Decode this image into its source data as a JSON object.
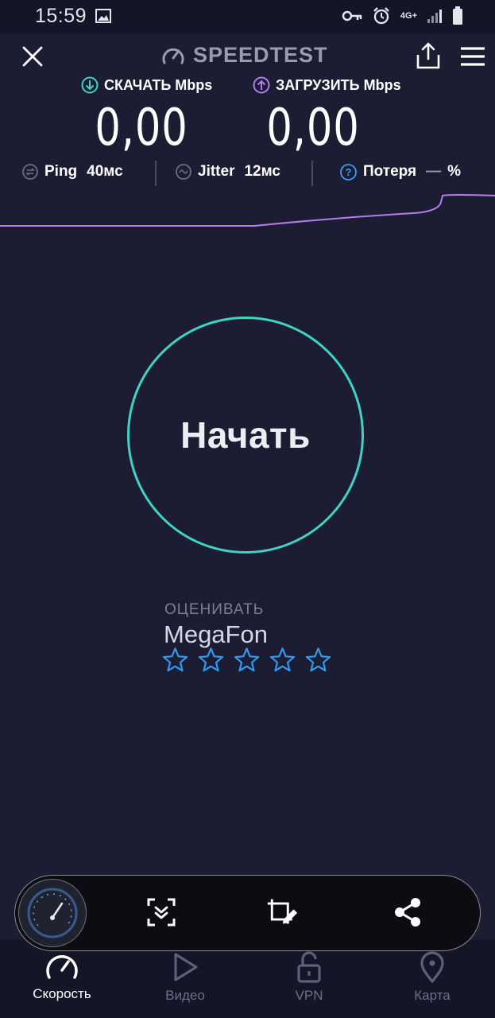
{
  "status_bar": {
    "time": "15:59",
    "network": "4G+"
  },
  "header": {
    "title": "SPEEDTEST"
  },
  "download": {
    "label": "СКАЧАТЬ Mbps",
    "value": "0,00"
  },
  "upload": {
    "label": "ЗАГРУЗИТЬ Mbps",
    "value": "0,00"
  },
  "stats": {
    "ping": {
      "label": "Ping",
      "value": "40мс"
    },
    "jitter": {
      "label": "Jitter",
      "value": "12мс"
    },
    "loss": {
      "label": "Потеря",
      "value": "—",
      "unit": "%"
    }
  },
  "start_button": {
    "label": "Начать"
  },
  "rating": {
    "label": "ОЦЕНИВАТЬ",
    "isp": "MegaFon",
    "stars": 5,
    "filled": 0
  },
  "bottom_nav": [
    {
      "label": "Скорость",
      "icon": "speedometer-icon",
      "active": true
    },
    {
      "label": "Видео",
      "icon": "play-icon",
      "active": false
    },
    {
      "label": "VPN",
      "icon": "lock-icon",
      "active": false
    },
    {
      "label": "Карта",
      "icon": "map-pin-icon",
      "active": false
    }
  ],
  "colors": {
    "background": "#1c1d33",
    "download_accent": "#3fd3c3",
    "upload_accent": "#b57cf0",
    "info_blue": "#3a9ff5",
    "star_blue": "#2f9cf4"
  }
}
